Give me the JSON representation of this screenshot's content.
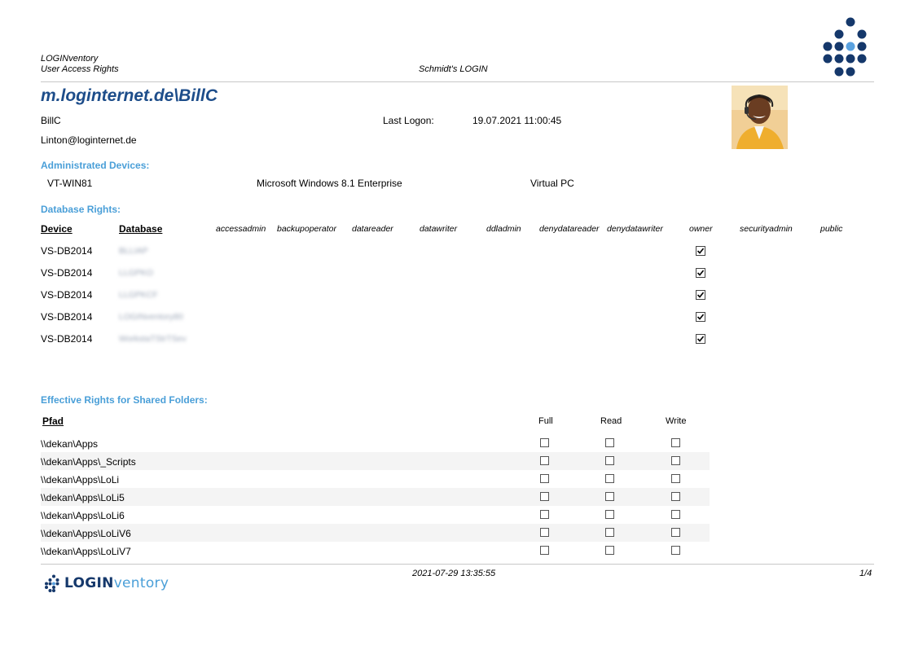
{
  "header": {
    "app_name": "LOGINventory",
    "report_name": "User Access Rights",
    "center_title": "Schmidt's LOGIN",
    "logo_icon": "dot-hexagon-logo-icon"
  },
  "user": {
    "account": "m.loginternet.de\\BillC",
    "name": "BillC",
    "email": "Linton@loginternet.de",
    "last_logon_label": "Last Logon:",
    "last_logon_value": "19.07.2021 11:00:45",
    "photo_icon": "user-photo"
  },
  "devices": {
    "section_title": "Administrated Devices:",
    "rows": [
      {
        "name": "VT-WIN81",
        "os": "Microsoft Windows 8.1 Enterprise",
        "type": "Virtual PC"
      }
    ]
  },
  "db_rights": {
    "section_title": "Database Rights:",
    "col_device": "Device",
    "col_database": "Database",
    "role_columns": [
      "accessadmin",
      "backupoperator",
      "datareader",
      "datawriter",
      "ddladmin",
      "denydatareader",
      "denydatawriter",
      "owner",
      "securityadmin",
      "public"
    ],
    "rows": [
      {
        "device": "VS-DB2014",
        "database": "BLLIAP",
        "owner": true
      },
      {
        "device": "VS-DB2014",
        "database": "LLGPKO",
        "owner": true
      },
      {
        "device": "VS-DB2014",
        "database": "LLGPKCF",
        "owner": true
      },
      {
        "device": "VS-DB2014",
        "database": "LOGINventory80",
        "owner": true
      },
      {
        "device": "VS-DB2014",
        "database": "WorkstaTStrTSev",
        "owner": true
      }
    ]
  },
  "shared_folders": {
    "section_title": "Effective Rights for Shared Folders:",
    "col_path": "Pfad",
    "col_full": "Full",
    "col_read": "Read",
    "col_write": "Write",
    "rows": [
      {
        "path": "\\\\dekan\\Apps",
        "full": false,
        "read": false,
        "write": false
      },
      {
        "path": "\\\\dekan\\Apps\\_Scripts",
        "full": false,
        "read": false,
        "write": false
      },
      {
        "path": "\\\\dekan\\Apps\\LoLi",
        "full": false,
        "read": false,
        "write": false
      },
      {
        "path": "\\\\dekan\\Apps\\LoLi5",
        "full": false,
        "read": false,
        "write": false
      },
      {
        "path": "\\\\dekan\\Apps\\LoLi6",
        "full": false,
        "read": false,
        "write": false
      },
      {
        "path": "\\\\dekan\\Apps\\LoLiV6",
        "full": false,
        "read": false,
        "write": false
      },
      {
        "path": "\\\\dekan\\Apps\\LoLiV7",
        "full": false,
        "read": false,
        "write": false
      }
    ]
  },
  "footer": {
    "timestamp": "2021-07-29 13:35:55",
    "page": "1/4",
    "logo_text_bold": "LOGIN",
    "logo_text_light": "ventory"
  },
  "colors": {
    "title_blue": "#1d4d8a",
    "section_blue": "#4a9fd8",
    "logo_navy": "#15386b",
    "logo_accent": "#5aa2e0"
  }
}
